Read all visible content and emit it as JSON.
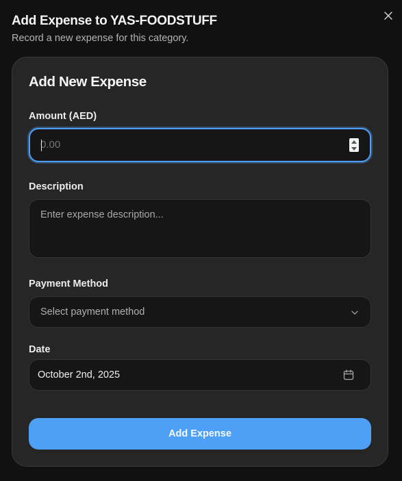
{
  "dialog": {
    "title": "Add Expense to YAS-FOODSTUFF",
    "subtitle": "Record a new expense for this category.",
    "close_icon": "close-icon"
  },
  "form": {
    "title": "Add New Expense",
    "amount": {
      "label": "Amount (AED)",
      "value": "",
      "placeholder": "0.00"
    },
    "description": {
      "label": "Description",
      "value": "",
      "placeholder": "Enter expense description..."
    },
    "payment_method": {
      "label": "Payment Method",
      "placeholder": "Select payment method",
      "icon": "chevron-down-icon"
    },
    "date": {
      "label": "Date",
      "value": "October 2nd, 2025",
      "icon": "calendar-icon"
    },
    "submit_label": "Add Expense"
  },
  "colors": {
    "accent": "#4ea0f6",
    "focus_ring": "#4f9ff7",
    "card_bg": "#262627",
    "input_bg": "#161617"
  }
}
